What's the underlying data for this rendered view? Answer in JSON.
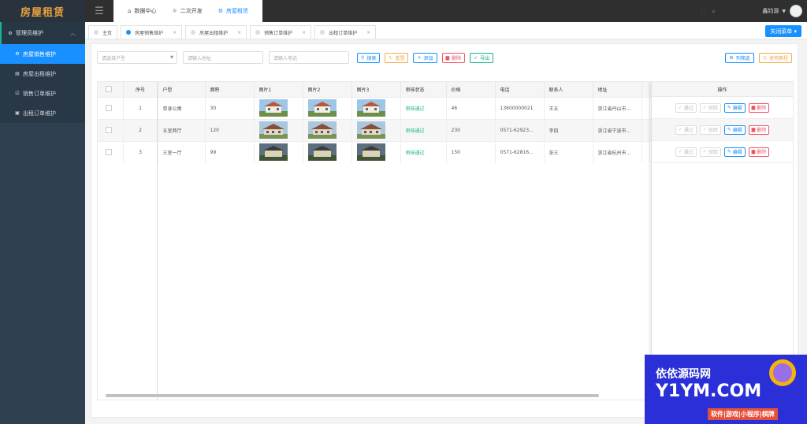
{
  "app": {
    "logo": "房屋租赁"
  },
  "sidebar": {
    "parent": "管理员维护",
    "items": [
      {
        "label": "房屋销售维护",
        "active": true
      },
      {
        "label": "房屋出租维护"
      },
      {
        "label": "销售订单维护"
      },
      {
        "label": "出租订单维护"
      }
    ]
  },
  "topnav": {
    "items": [
      {
        "label": "数据中心",
        "icon": "home-icon"
      },
      {
        "label": "二次开发",
        "icon": "bulb-icon"
      },
      {
        "label": "房屋租赁",
        "icon": "gear-icon",
        "active": true
      }
    ]
  },
  "header": {
    "username": "鑫钧源"
  },
  "tabs": [
    {
      "label": "主页"
    },
    {
      "label": "房屋销售维护",
      "active": true
    },
    {
      "label": "房屋出租维护"
    },
    {
      "label": "销售订单维护"
    },
    {
      "label": "出租订单维护"
    }
  ],
  "close_menu": "关闭菜单",
  "toolbar": {
    "select_placeholder": "请选择户型",
    "address_placeholder": "请输入地址",
    "phone_placeholder": "请输入电话",
    "search": "搜索",
    "reset": "重置",
    "add": "添加",
    "delete": "删除",
    "export": "导出",
    "column_filter": "列筛选",
    "tutorial": "使用教程"
  },
  "table": {
    "headers": [
      "序号",
      "户型",
      "面积",
      "图片1",
      "图片2",
      "图片3",
      "审核状态",
      "价格",
      "电话",
      "联系人",
      "地址",
      "操作"
    ],
    "rows": [
      {
        "no": "1",
        "type": "单身公寓",
        "area": "30",
        "status": "审核通过",
        "price": "46",
        "phone": "13600000021",
        "contact": "王五",
        "address": "浙江省丹山市..."
      },
      {
        "no": "2",
        "type": "五室两厅",
        "area": "120",
        "status": "审核通过",
        "price": "230",
        "phone": "0571-62923...",
        "contact": "李四",
        "address": "浙江省宁波市..."
      },
      {
        "no": "3",
        "type": "三室一厅",
        "area": "99",
        "status": "审核通过",
        "price": "150",
        "phone": "0571-62816...",
        "contact": "张三",
        "address": "浙江省杭州市..."
      }
    ],
    "ops": {
      "pass": "通过",
      "reject": "驳回",
      "edit": "编辑",
      "delete": "删除"
    }
  },
  "watermark": {
    "line1": "依依源码网",
    "line2": "Y1YM.COM",
    "line3": "软件|游戏|小程序|棋牌"
  }
}
